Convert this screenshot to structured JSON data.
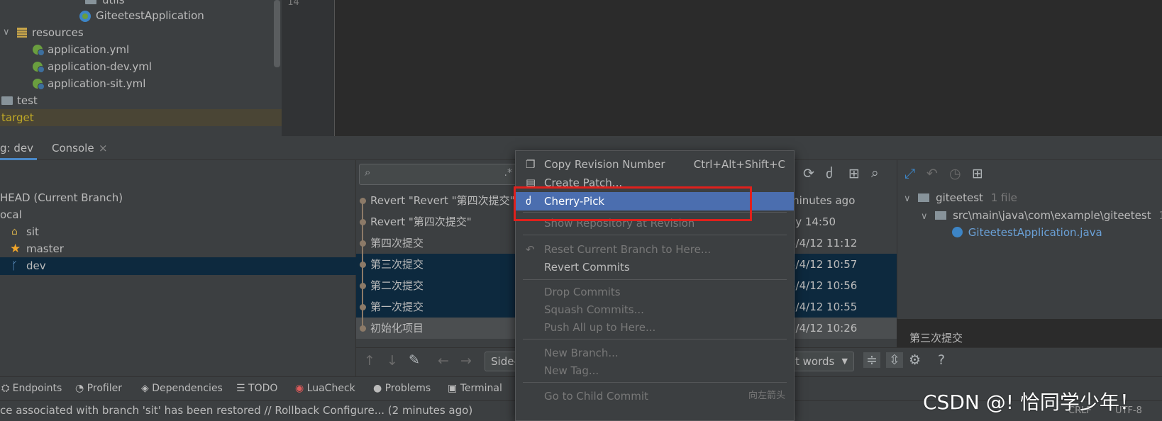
{
  "colors": {
    "selection_blue": "#4b6eaf",
    "row_selected": "#0d293e",
    "highlight_box": "#e0201c",
    "target_text": "#bfa826"
  },
  "project_tree": {
    "items": [
      {
        "label": "utils",
        "icon": "folder-icon"
      },
      {
        "label": "GiteetestApplication",
        "icon": "spring-app-icon"
      },
      {
        "label": "resources",
        "icon": "resources-folder-icon"
      },
      {
        "label": "application.yml",
        "icon": "spring-config-icon"
      },
      {
        "label": "application-dev.yml",
        "icon": "spring-config-icon"
      },
      {
        "label": "application-sit.yml",
        "icon": "spring-config-icon"
      },
      {
        "label": "test",
        "icon": "folder-icon"
      },
      {
        "label": "target",
        "icon": "folder-icon"
      }
    ]
  },
  "editor": {
    "line_number": "14"
  },
  "tool_tabs": {
    "git_tab": "g: dev",
    "console_tab": "Console",
    "close_symbol": "×"
  },
  "branches": {
    "items": [
      {
        "label": "HEAD (Current Branch)",
        "icon": ""
      },
      {
        "label": "ocal",
        "icon": ""
      },
      {
        "label": "sit",
        "icon": "tag-icon"
      },
      {
        "label": "master",
        "icon": "star-icon"
      },
      {
        "label": "dev",
        "icon": "branch-icon"
      }
    ]
  },
  "log": {
    "search_placeholder": "",
    "commits": [
      {
        "message": "Revert \"Revert \"第四次提交\"",
        "date": "minutes ago",
        "state": "normal"
      },
      {
        "message": "Revert \"第四次提交\"",
        "date": "ay 14:50",
        "state": "normal"
      },
      {
        "message": "第四次提交",
        "date": "5/4/12 11:12",
        "state": "normal"
      },
      {
        "message": "第三次提交",
        "date": "5/4/12 10:57",
        "state": "selected"
      },
      {
        "message": "第二次提交",
        "date": "5/4/12 10:56",
        "state": "selected"
      },
      {
        "message": "第一次提交",
        "date": "5/4/12 10:55",
        "state": "selected"
      },
      {
        "message": "初始化项目",
        "date": "5/4/12 10:26",
        "state": "hover"
      }
    ]
  },
  "details": {
    "root_label": "giteetest",
    "root_count": "1 file",
    "path_label": "src\\main\\java\\com\\example\\giteetest",
    "path_count": "1",
    "file_label": "GiteetestApplication.java",
    "commit_message": "第三次提交"
  },
  "diff_toolbar": {
    "viewer_combo": "Side-",
    "words_combo": "t words"
  },
  "context_menu": {
    "items": [
      {
        "label": "Copy Revision Number",
        "shortcut": "Ctrl+Alt+Shift+C",
        "icon": "copy-icon",
        "state": "enabled"
      },
      {
        "label": "Create Patch...",
        "shortcut": "",
        "icon": "patch-icon",
        "state": "enabled"
      },
      {
        "label": "Cherry-Pick",
        "shortcut": "",
        "icon": "cherry-icon",
        "state": "selected"
      },
      {
        "label": "Show Repository at Revision",
        "shortcut": "",
        "icon": "",
        "state": "disabled"
      },
      {
        "label": "Reset Current Branch to Here...",
        "shortcut": "",
        "icon": "undo-icon",
        "state": "disabled"
      },
      {
        "label": "Revert Commits",
        "shortcut": "",
        "icon": "",
        "state": "enabled"
      },
      {
        "label": "Drop Commits",
        "shortcut": "",
        "icon": "",
        "state": "disabled"
      },
      {
        "label": "Squash Commits...",
        "shortcut": "",
        "icon": "",
        "state": "disabled"
      },
      {
        "label": "Push All up to Here...",
        "shortcut": "",
        "icon": "",
        "state": "disabled"
      },
      {
        "label": "New Branch...",
        "shortcut": "",
        "icon": "",
        "state": "disabled"
      },
      {
        "label": "New Tag...",
        "shortcut": "",
        "icon": "",
        "state": "disabled"
      },
      {
        "label": "Go to Child Commit",
        "shortcut": "向左箭头",
        "icon": "",
        "state": "disabled"
      }
    ]
  },
  "bottom_tools": {
    "items": [
      {
        "label": "Endpoints",
        "icon": "endpoints-icon"
      },
      {
        "label": "Profiler",
        "icon": "profiler-icon"
      },
      {
        "label": "Dependencies",
        "icon": "dependencies-icon"
      },
      {
        "label": "TODO",
        "icon": "todo-icon"
      },
      {
        "label": "LuaCheck",
        "icon": "luacheck-icon"
      },
      {
        "label": "Problems",
        "icon": "problems-icon"
      },
      {
        "label": "Terminal",
        "icon": "terminal-icon"
      }
    ]
  },
  "status": {
    "message": "ce associated with branch 'sit' has been restored // Rollback   Configure... (2 minutes ago)",
    "encoding_fragment": "UTF-8",
    "line_sep_fragment": "CRLF"
  },
  "watermark": "CSDN @! 恰同学少年！"
}
